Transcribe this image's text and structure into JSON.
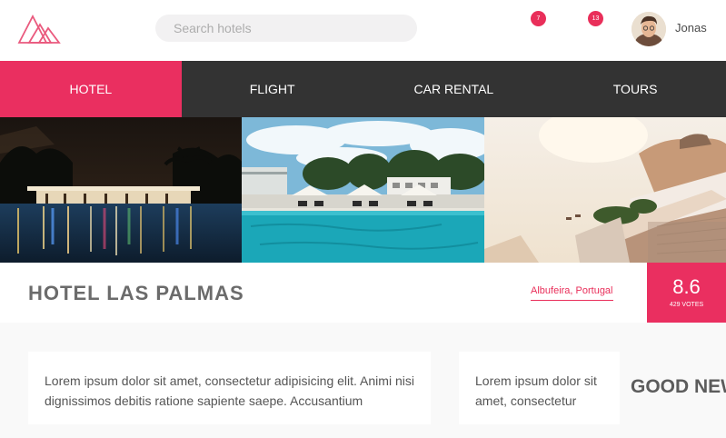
{
  "header": {
    "search_placeholder": "Search hotels",
    "notifications": [
      {
        "icon": "bell-icon",
        "count": "7"
      },
      {
        "icon": "envelope-icon",
        "count": "13"
      }
    ],
    "user": {
      "name": "Jonas",
      "avatar_icon": "user-avatar"
    }
  },
  "tabs": [
    {
      "label": "HOTEL",
      "active": true
    },
    {
      "label": "FLIGHT",
      "active": false
    },
    {
      "label": "CAR RENTAL",
      "active": false
    },
    {
      "label": "TOURS",
      "active": false
    }
  ],
  "gallery": [
    {
      "subject": "night-pool-photo"
    },
    {
      "subject": "day-pool-photo"
    },
    {
      "subject": "seaside-terrace-photo"
    }
  ],
  "hotel": {
    "name": "HOTEL LAS PALMAS",
    "location": "Albufeira, Portugal",
    "rating": "8.6",
    "votes": "429 VOTES"
  },
  "content": {
    "description": "Lorem ipsum dolor sit amet, consectetur adipisicing elit. Animi nisi dignissimos debitis ratione sapiente saepe. Accusantium",
    "review": "Lorem ipsum dolor sit amet, consectetur",
    "news_title": "GOOD NEWS"
  },
  "colors": {
    "accent": "#ea2f60",
    "nav_bar": "#333333",
    "page_bg": "#f9f9f9"
  }
}
